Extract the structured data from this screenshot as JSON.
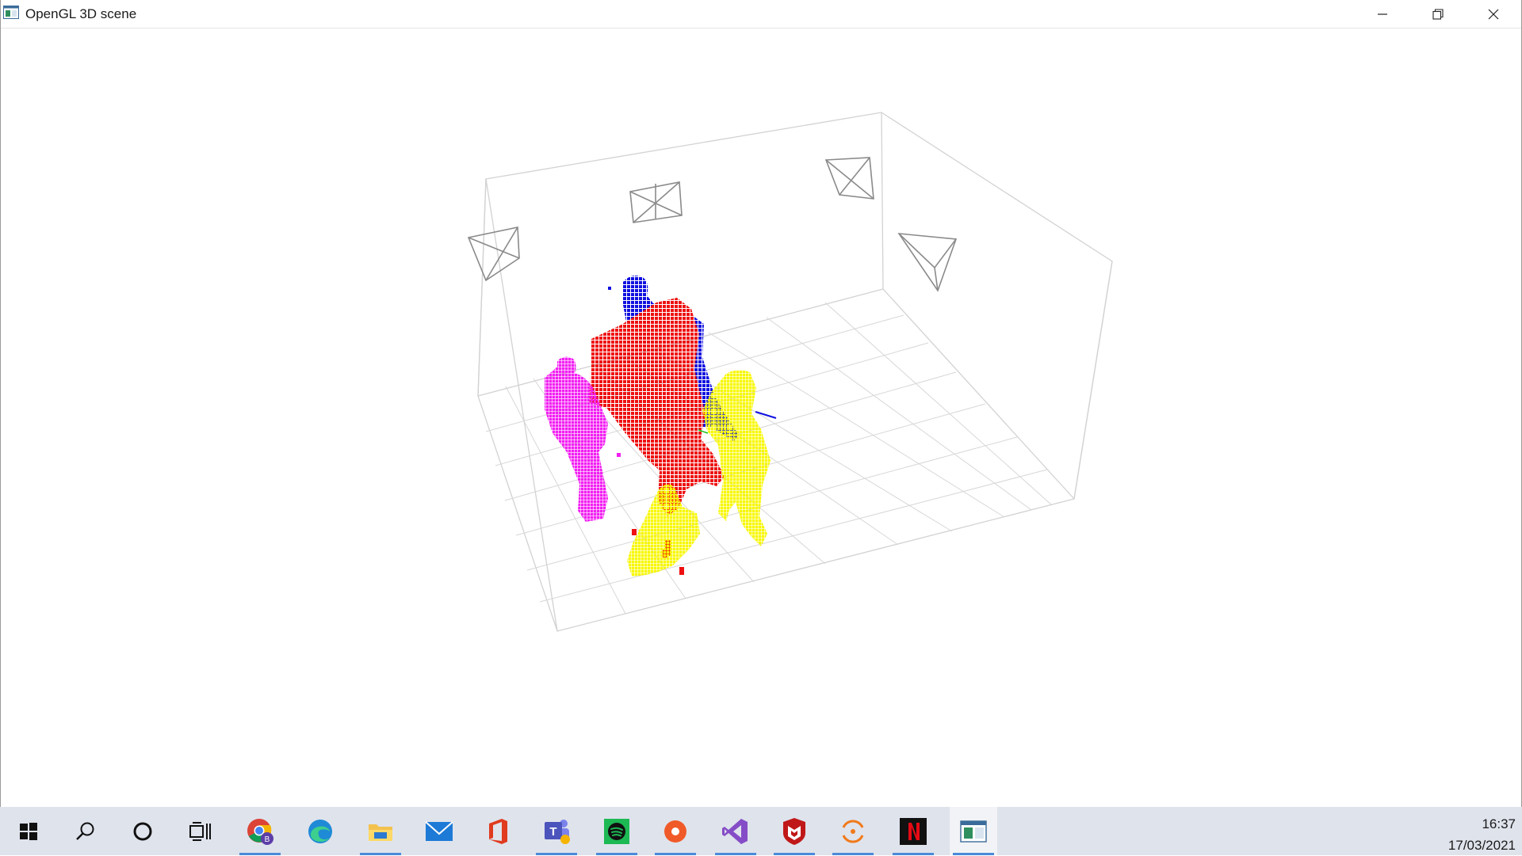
{
  "window": {
    "title": "OpenGL 3D scene",
    "controls": {
      "minimize": "minimize-icon",
      "maximize": "restore-icon",
      "close": "close-icon"
    }
  },
  "scene": {
    "description_colors": {
      "box_lines": "#cfcfcf",
      "camera_frustums": "#8a8a8a",
      "person_blue": "#1010e0",
      "person_red": "#ee1010",
      "person_magenta": "#f21ef2",
      "person_yellow": "#f7f700"
    }
  },
  "taskbar": {
    "items": [
      {
        "name": "start-icon"
      },
      {
        "name": "search-icon"
      },
      {
        "name": "cortana-icon"
      },
      {
        "name": "task-view-icon"
      },
      {
        "name": "chrome-icon",
        "running": true
      },
      {
        "name": "edge-icon"
      },
      {
        "name": "file-explorer-icon",
        "running": true
      },
      {
        "name": "mail-icon"
      },
      {
        "name": "office-icon"
      },
      {
        "name": "teams-icon",
        "running": true
      },
      {
        "name": "spotify-icon",
        "running": true
      },
      {
        "name": "app-orange-icon",
        "running": true
      },
      {
        "name": "visual-studio-icon",
        "running": true
      },
      {
        "name": "mcafee-icon",
        "running": true
      },
      {
        "name": "app-ring-icon",
        "running": true
      },
      {
        "name": "netflix-icon",
        "running": true
      },
      {
        "name": "opengl-app-icon",
        "running": true,
        "active": true
      }
    ],
    "clock": {
      "time": "16:37",
      "date": "17/03/2021"
    }
  }
}
